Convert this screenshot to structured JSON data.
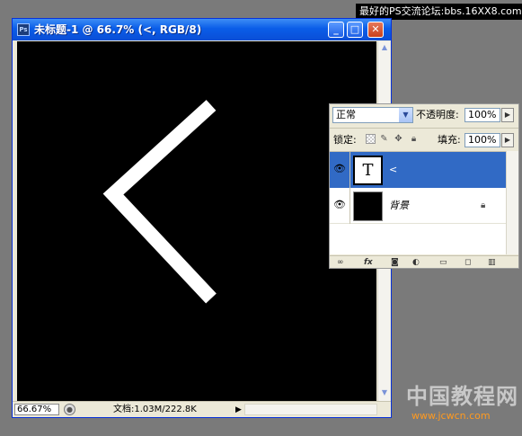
{
  "watermark": "最好的PS交流论坛:bbs.16XX8.com",
  "document": {
    "title": "未标题-1 @ 66.7% (<, RGB/8)",
    "app_icon": "Ps",
    "status": {
      "zoom": "66.67%",
      "doc_info": "文档:1.03M/222.8K"
    }
  },
  "layers_panel": {
    "blend_mode": "正常",
    "opacity_label": "不透明度:",
    "opacity_value": "100%",
    "lock_label": "锁定:",
    "fill_label": "填充:",
    "fill_value": "100%",
    "layers": [
      {
        "name": "<",
        "thumbnail": "T",
        "visible": true,
        "selected": true
      },
      {
        "name": "背景",
        "thumbnail": "",
        "visible": true,
        "selected": false,
        "locked": true
      }
    ]
  },
  "logo": {
    "site_name": "中国教程网",
    "url": "www.jcwcn.com"
  },
  "colors": {
    "titlebar": "#0a5de8",
    "canvas": "#000000",
    "selected_layer": "#316ac5",
    "desktop": "#7a7a7a"
  }
}
